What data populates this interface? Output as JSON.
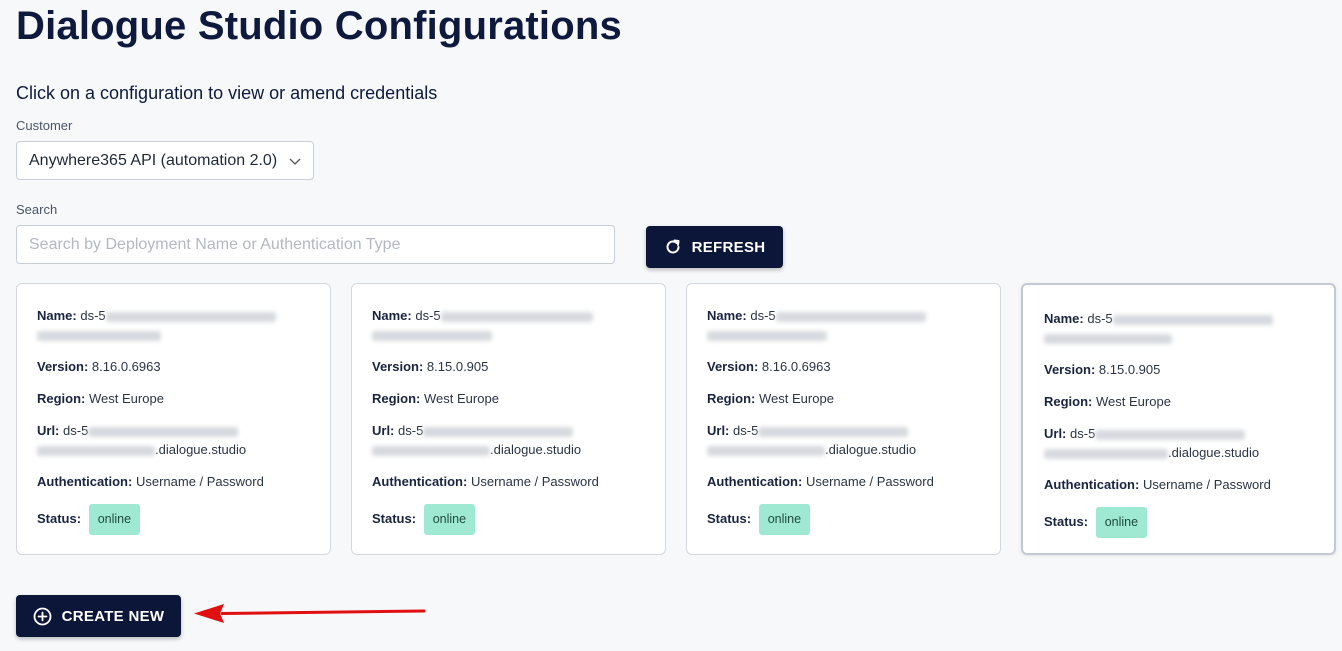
{
  "page": {
    "title": "Dialogue Studio Configurations",
    "subtitle": "Click on a configuration to view or amend credentials"
  },
  "customer": {
    "label": "Customer",
    "selected": "Anywhere365 API (automation 2.0)"
  },
  "search": {
    "label": "Search",
    "placeholder": "Search by Deployment Name or Authentication Type",
    "value": ""
  },
  "buttons": {
    "refresh": "REFRESH",
    "create_new": "CREATE NEW"
  },
  "labels": {
    "name": "Name:",
    "version": "Version:",
    "region": "Region:",
    "url": "Url:",
    "authentication": "Authentication:",
    "status": "Status:"
  },
  "cards": [
    {
      "name_prefix": "ds-5",
      "version": "8.16.0.6963",
      "region": "West Europe",
      "url_prefix": "ds-5",
      "url_suffix": ".dialogue.studio",
      "authentication": "Username / Password",
      "status": "online"
    },
    {
      "name_prefix": "ds-5",
      "version": "8.15.0.905",
      "region": "West Europe",
      "url_prefix": "ds-5",
      "url_suffix": ".dialogue.studio",
      "authentication": "Username / Password",
      "status": "online"
    },
    {
      "name_prefix": "ds-5",
      "version": "8.16.0.6963",
      "region": "West Europe",
      "url_prefix": "ds-5",
      "url_suffix": ".dialogue.studio",
      "authentication": "Username / Password",
      "status": "online"
    },
    {
      "name_prefix": "ds-5",
      "version": "8.15.0.905",
      "region": "West Europe",
      "url_prefix": "ds-5",
      "url_suffix": ".dialogue.studio",
      "authentication": "Username / Password",
      "status": "online"
    }
  ],
  "colors": {
    "primary": "#0b1638",
    "status_online_bg": "#9fe8d2",
    "annotation_arrow": "#e01010"
  },
  "icons": {
    "refresh": "refresh-icon",
    "create": "plus-circle-icon",
    "dropdown": "chevron-down-icon"
  }
}
